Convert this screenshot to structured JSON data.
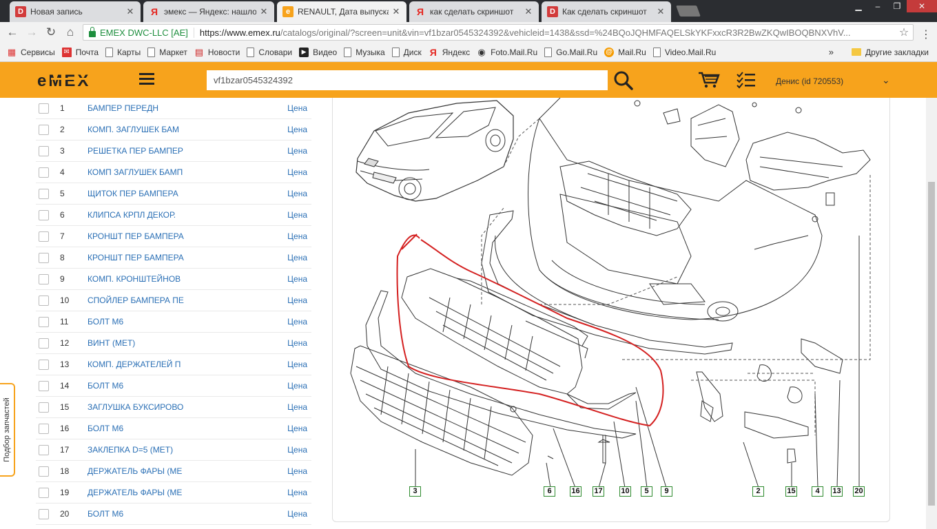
{
  "browser": {
    "tabs": [
      {
        "title": "Новая запись",
        "favicon": "D",
        "favicon_color": "#d23b3b",
        "active": false
      },
      {
        "title": "эмекс — Яндекс: нашлось",
        "favicon": "Я",
        "favicon_color": "#e52620",
        "active": false
      },
      {
        "title": "RENAULT, Дата выпуска",
        "favicon": "e",
        "favicon_color": "#f7a31c",
        "active": true
      },
      {
        "title": "как сделать скриншот",
        "favicon": "Я",
        "favicon_color": "#e52620",
        "active": false
      },
      {
        "title": "Как сделать скриншот",
        "favicon": "D",
        "favicon_color": "#d23b3b",
        "active": false
      }
    ],
    "secure_label": "EMEX DWC-LLC [AE]",
    "url_host": "https://www.emex.ru",
    "url_rest": "/catalogs/original/?screen=unit&vin=vf1bzar0545324392&vehicleid=1438&ssd=%24BQoJQHMFAQELSkYKFxxcR3R2BwZKQwIBOQBNXVhV...",
    "bookmarks": [
      {
        "label": "Сервисы",
        "icon": "apps-icon"
      },
      {
        "label": "Почта",
        "icon": "mail-icon"
      },
      {
        "label": "Карты",
        "icon": "page-icon"
      },
      {
        "label": "Маркет",
        "icon": "page-icon"
      },
      {
        "label": "Новости",
        "icon": "news-icon"
      },
      {
        "label": "Словари",
        "icon": "page-icon"
      },
      {
        "label": "Видео",
        "icon": "video-icon"
      },
      {
        "label": "Музыка",
        "icon": "page-icon"
      },
      {
        "label": "Диск",
        "icon": "page-icon"
      },
      {
        "label": "Яндекс",
        "icon": "yandex-icon"
      },
      {
        "label": "Foto.Mail.Ru",
        "icon": "camera-icon"
      },
      {
        "label": "Go.Mail.Ru",
        "icon": "page-icon"
      },
      {
        "label": "Mail.Ru",
        "icon": "at-icon"
      },
      {
        "label": "Video.Mail.Ru",
        "icon": "page-icon"
      }
    ],
    "bookmarks_more": "»",
    "other_bookmarks": "Другие закладки"
  },
  "header": {
    "logo": "eMEX",
    "search_value": "vf1bzar0545324392",
    "user_label": "Денис  (id 720553)",
    "brand_color": "#f7a31c"
  },
  "side_tab": "Подбор запчастей",
  "parts": [
    {
      "num": "1",
      "name": "БАМПЕР ПЕРЕДН",
      "price": "Цена"
    },
    {
      "num": "2",
      "name": "КОМП. ЗАГЛУШЕК БАМ",
      "price": "Цена"
    },
    {
      "num": "3",
      "name": "РЕШЕТКА ПЕР БАМПЕР",
      "price": "Цена"
    },
    {
      "num": "4",
      "name": "КОМП ЗАГЛУШЕК БАМП",
      "price": "Цена"
    },
    {
      "num": "5",
      "name": "ЩИТОК ПЕР БАМПЕРА",
      "price": "Цена"
    },
    {
      "num": "6",
      "name": "КЛИПСА КРПЛ ДЕКОР.",
      "price": "Цена"
    },
    {
      "num": "7",
      "name": "КРОНШТ ПЕР БАМПЕРА",
      "price": "Цена"
    },
    {
      "num": "8",
      "name": "КРОНШТ ПЕР БАМПЕРА",
      "price": "Цена"
    },
    {
      "num": "9",
      "name": "КОМП. КРОНШТЕЙНОВ",
      "price": "Цена"
    },
    {
      "num": "10",
      "name": "СПОЙЛЕР БАМПЕРА ПЕ",
      "price": "Цена"
    },
    {
      "num": "11",
      "name": "БОЛТ М6",
      "price": "Цена"
    },
    {
      "num": "12",
      "name": "ВИНТ (МЕТ)",
      "price": "Цена"
    },
    {
      "num": "13",
      "name": "КОМП. ДЕРЖАТЕЛЕЙ П",
      "price": "Цена"
    },
    {
      "num": "14",
      "name": "БОЛТ М6",
      "price": "Цена"
    },
    {
      "num": "15",
      "name": "ЗАГЛУШКА БУКСИРОВО",
      "price": "Цена"
    },
    {
      "num": "16",
      "name": "БОЛТ М6",
      "price": "Цена"
    },
    {
      "num": "17",
      "name": "ЗАКЛЕПКА D=5 (МЕТ)",
      "price": "Цена"
    },
    {
      "num": "18",
      "name": "ДЕРЖАТЕЛЬ ФАРЫ (МЕ",
      "price": "Цена"
    },
    {
      "num": "19",
      "name": "ДЕРЖАТЕЛЬ ФАРЫ (МЕ",
      "price": "Цена"
    },
    {
      "num": "20",
      "name": "БОЛТ М6",
      "price": "Цена"
    }
  ],
  "diagram_callouts": [
    "3",
    "6",
    "16",
    "17",
    "10",
    "5",
    "9",
    "2",
    "15",
    "4",
    "13",
    "20"
  ]
}
